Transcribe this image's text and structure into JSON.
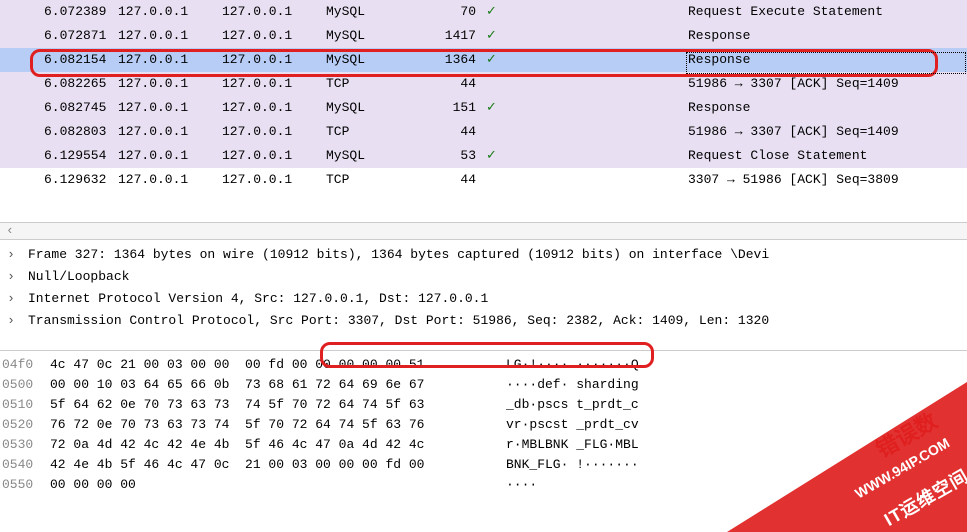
{
  "packets": [
    {
      "time": "6.072389",
      "src": "127.0.0.1",
      "dst": "127.0.0.1",
      "proto": "MySQL",
      "len": "70",
      "chk": "✓",
      "info": "Request Execute Statement",
      "cls": "row-lavender"
    },
    {
      "time": "6.072871",
      "src": "127.0.0.1",
      "dst": "127.0.0.1",
      "proto": "MySQL",
      "len": "1417",
      "chk": "✓",
      "info": "Response",
      "cls": "row-lavender"
    },
    {
      "time": "6.082154",
      "src": "127.0.0.1",
      "dst": "127.0.0.1",
      "proto": "MySQL",
      "len": "1364",
      "chk": "✓",
      "info": "Response",
      "cls": "row-selected"
    },
    {
      "time": "6.082265",
      "src": "127.0.0.1",
      "dst": "127.0.0.1",
      "proto": "TCP",
      "len": "44",
      "chk": "",
      "info": "51986 → 3307 [ACK] Seq=1409",
      "cls": "row-lavender"
    },
    {
      "time": "6.082745",
      "src": "127.0.0.1",
      "dst": "127.0.0.1",
      "proto": "MySQL",
      "len": "151",
      "chk": "✓",
      "info": "Response",
      "cls": "row-lavender"
    },
    {
      "time": "6.082803",
      "src": "127.0.0.1",
      "dst": "127.0.0.1",
      "proto": "TCP",
      "len": "44",
      "chk": "",
      "info": "51986 → 3307 [ACK] Seq=1409",
      "cls": "row-lavender"
    },
    {
      "time": "6.129554",
      "src": "127.0.0.1",
      "dst": "127.0.0.1",
      "proto": "MySQL",
      "len": "53",
      "chk": "✓",
      "info": "Request Close Statement",
      "cls": "row-lavender"
    },
    {
      "time": "6.129632",
      "src": "127.0.0.1",
      "dst": "127.0.0.1",
      "proto": "TCP",
      "len": "44",
      "chk": "",
      "info": "3307 → 51986 [ACK] Seq=3809",
      "cls": "row-default"
    }
  ],
  "details": [
    {
      "exp": "›",
      "text": "Frame 327: 1364 bytes on wire (10912 bits), 1364 bytes captured (10912 bits) on interface \\Devi"
    },
    {
      "exp": "›",
      "text": "Null/Loopback"
    },
    {
      "exp": "›",
      "text": "Internet Protocol Version 4, Src: 127.0.0.1, Dst: 127.0.0.1"
    },
    {
      "exp": "›",
      "text": "Transmission Control Protocol, Src Port: 3307, Dst Port: 51986, Seq: 2382, Ack: 1409, Len: 1320"
    }
  ],
  "hex": [
    {
      "off": "04f0",
      "bytes": "4c 47 0c 21 00 03 00 00  00 fd 00 00 00 00 00 51",
      "ascii": "LG·!···· ·······Q"
    },
    {
      "off": "0500",
      "bytes": "00 00 10 03 64 65 66 0b  73 68 61 72 64 69 6e 67",
      "ascii": "····def· sharding"
    },
    {
      "off": "0510",
      "bytes": "5f 64 62 0e 70 73 63 73  74 5f 70 72 64 74 5f 63",
      "ascii": "_db·pscs t_prdt_c"
    },
    {
      "off": "0520",
      "bytes": "76 72 0e 70 73 63 73 74  5f 70 72 64 74 5f 63 76",
      "ascii": "vr·pscst _prdt_cv"
    },
    {
      "off": "0530",
      "bytes": "72 0a 4d 42 4c 42 4e 4b  5f 46 4c 47 0a 4d 42 4c",
      "ascii": "r·MBLBNK _FLG·MBL"
    },
    {
      "off": "0540",
      "bytes": "42 4e 4b 5f 46 4c 47 0c  21 00 03 00 00 00 fd 00",
      "ascii": "BNK_FLG· !·······"
    },
    {
      "off": "0550",
      "bytes": "00 00 00 00",
      "ascii": "····"
    }
  ],
  "scroll_hint": "‹",
  "wm": {
    "red": "错误数",
    "url": "WWW.94IP.COM",
    "brand": "IT运维空间"
  }
}
